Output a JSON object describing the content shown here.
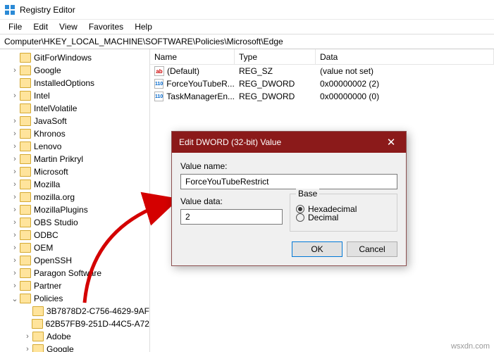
{
  "window": {
    "title": "Registry Editor"
  },
  "menu": {
    "file": "File",
    "edit": "Edit",
    "view": "View",
    "favorites": "Favorites",
    "help": "Help"
  },
  "address": {
    "path": "Computer\\HKEY_LOCAL_MACHINE\\SOFTWARE\\Policies\\Microsoft\\Edge"
  },
  "tree": {
    "items": [
      {
        "label": "GitForWindows",
        "tw": ""
      },
      {
        "label": "Google",
        "tw": ">"
      },
      {
        "label": "InstalledOptions",
        "tw": ""
      },
      {
        "label": "Intel",
        "tw": ">"
      },
      {
        "label": "IntelVolatile",
        "tw": ""
      },
      {
        "label": "JavaSoft",
        "tw": ">"
      },
      {
        "label": "Khronos",
        "tw": ">"
      },
      {
        "label": "Lenovo",
        "tw": ">"
      },
      {
        "label": "Martin Prikryl",
        "tw": ">"
      },
      {
        "label": "Microsoft",
        "tw": ">"
      },
      {
        "label": "Mozilla",
        "tw": ">"
      },
      {
        "label": "mozilla.org",
        "tw": ">"
      },
      {
        "label": "MozillaPlugins",
        "tw": ">"
      },
      {
        "label": "OBS Studio",
        "tw": ">"
      },
      {
        "label": "ODBC",
        "tw": ">"
      },
      {
        "label": "OEM",
        "tw": ">"
      },
      {
        "label": "OpenSSH",
        "tw": ">"
      },
      {
        "label": "Paragon Software",
        "tw": ">"
      },
      {
        "label": "Partner",
        "tw": ">"
      },
      {
        "label": "Policies",
        "tw": "v",
        "expanded": true
      },
      {
        "label": "3B7878D2-C756-4629-9AF",
        "tw": "",
        "level": 2
      },
      {
        "label": "62B57FB9-251D-44C5-A72",
        "tw": "",
        "level": 2
      },
      {
        "label": "Adobe",
        "tw": ">",
        "level": 2
      },
      {
        "label": "Google",
        "tw": ">",
        "level": 2
      }
    ]
  },
  "list": {
    "headers": {
      "name": "Name",
      "type": "Type",
      "data": "Data"
    },
    "rows": [
      {
        "icon": "sz",
        "iconText": "ab",
        "name": "(Default)",
        "type": "REG_SZ",
        "data": "(value not set)"
      },
      {
        "icon": "dw",
        "iconText": "110",
        "name": "ForceYouTubeR...",
        "type": "REG_DWORD",
        "data": "0x00000002 (2)"
      },
      {
        "icon": "dw",
        "iconText": "110",
        "name": "TaskManagerEn...",
        "type": "REG_DWORD",
        "data": "0x00000000 (0)"
      }
    ]
  },
  "dialog": {
    "title": "Edit DWORD (32-bit) Value",
    "valueNameLabel": "Value name:",
    "valueName": "ForceYouTubeRestrict",
    "valueDataLabel": "Value data:",
    "valueData": "2",
    "baseLabel": "Base",
    "hex": "Hexadecimal",
    "dec": "Decimal",
    "ok": "OK",
    "cancel": "Cancel"
  },
  "watermark": "wsxdn.com"
}
